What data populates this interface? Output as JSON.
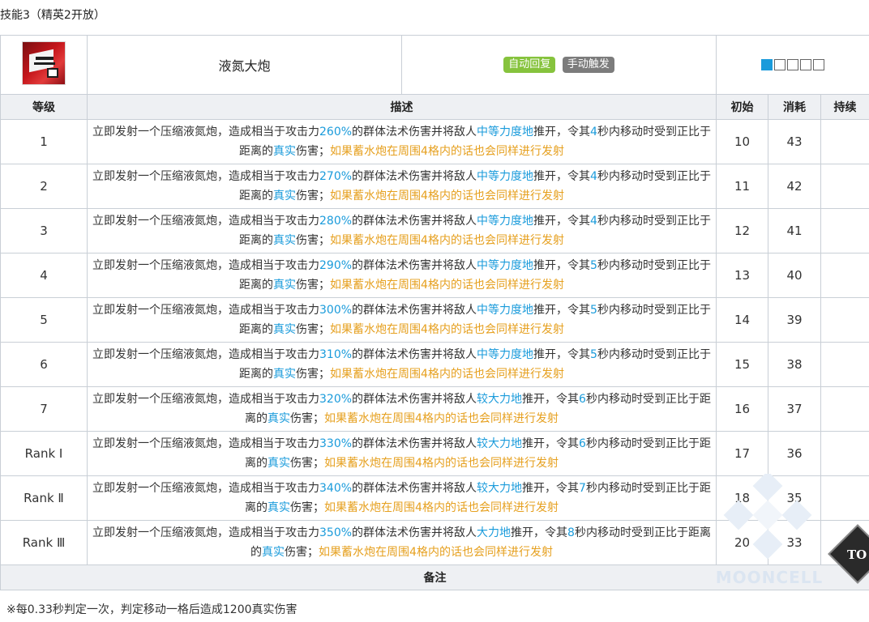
{
  "section_title": "技能3（精英2开放）",
  "skill": {
    "name": "液氮大炮",
    "tags": [
      "自动回复",
      "手动触发"
    ],
    "icon": "skill-icon-liquid-nitrogen-cannon",
    "charge_indicator": {
      "filled": 1,
      "total": 5
    }
  },
  "columns": [
    "等级",
    "描述",
    "初始",
    "消耗",
    "持续"
  ],
  "levels": [
    {
      "level": "1",
      "atk": "260%",
      "force": "中等力度地",
      "mid": "推开，令其",
      "sec": "4",
      "initial": "10",
      "cost": "43",
      "duration": ""
    },
    {
      "level": "2",
      "atk": "270%",
      "force": "中等力度地",
      "mid": "推开，令其",
      "sec": "4",
      "initial": "11",
      "cost": "42",
      "duration": ""
    },
    {
      "level": "3",
      "atk": "280%",
      "force": "中等力度地",
      "mid": "推开，令其",
      "sec": "4",
      "initial": "12",
      "cost": "41",
      "duration": ""
    },
    {
      "level": "4",
      "atk": "290%",
      "force": "中等力度地",
      "mid": "推开，令其",
      "sec": "5",
      "initial": "13",
      "cost": "40",
      "duration": ""
    },
    {
      "level": "5",
      "atk": "300%",
      "force": "中等力度地",
      "mid": "推开，令其",
      "sec": "5",
      "initial": "14",
      "cost": "39",
      "duration": ""
    },
    {
      "level": "6",
      "atk": "310%",
      "force": "中等力度地",
      "mid": "推开，令其",
      "sec": "5",
      "initial": "15",
      "cost": "38",
      "duration": ""
    },
    {
      "level": "7",
      "atk": "320%",
      "force": "较大力地",
      "mid": "推开，令其",
      "sec": "6",
      "initial": "16",
      "cost": "37",
      "duration": ""
    },
    {
      "level": "Rank Ⅰ",
      "atk": "330%",
      "force": "较大力地",
      "mid": "推开，令其",
      "sec": "6",
      "initial": "17",
      "cost": "36",
      "duration": ""
    },
    {
      "level": "Rank Ⅱ",
      "atk": "340%",
      "force": "较大力地",
      "mid": "推开，令其",
      "sec": "7",
      "initial": "18",
      "cost": "35",
      "duration": ""
    },
    {
      "level": "Rank Ⅲ",
      "atk": "350%",
      "force": "大力地",
      "mid": "推开，令其",
      "sec": "8",
      "initial": "20",
      "cost": "33",
      "duration": ""
    }
  ],
  "desc_parts": {
    "p1": "立即发射一个压缩液氮炮，造成相当于攻击力",
    "p2": "的群体法术伤害并将敌人",
    "p3": "秒内移动时受到正比于距离的",
    "true_dmg": "真实",
    "p4": "伤害；",
    "extra": "如果蓄水炮在周围4格内的话也会同样进行发射"
  },
  "notes_title": "备注",
  "note": "※每0.33秒判定一次，判定移动一格后造成1200真实伤害",
  "watermark": "MOONCELL",
  "top_button_label": "TO",
  "colors": {
    "value": "#1a9bdb",
    "highlight": "#e6a01f",
    "tag_auto": "#86c33d",
    "tag_manual": "#7c7c7c"
  }
}
